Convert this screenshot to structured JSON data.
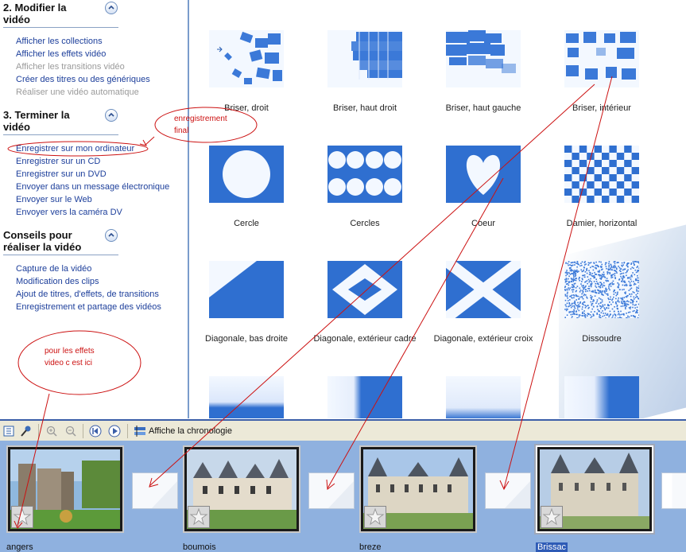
{
  "tasks": {
    "section2": {
      "title": "2. Modifier la vidéo",
      "title_l1": "2. Modifier la",
      "title_l2": "vidéo",
      "items": [
        "Afficher les collections",
        "Afficher les effets vidéo",
        "Afficher les transitions vidéo",
        "Créer des titres ou des génériques",
        "Réaliser une vidéo automatique"
      ]
    },
    "section3": {
      "title_l1": "3. Terminer la",
      "title_l2": "vidéo",
      "items": [
        "Enregistrer sur mon ordinateur",
        "Enregistrer sur un CD",
        "Enregistrer sur un DVD",
        "Envoyer dans un message électronique",
        "Envoyer sur le Web",
        "Envoyer vers la caméra DV"
      ]
    },
    "tips": {
      "title_l1": "Conseils pour",
      "title_l2": "réaliser la vidéo",
      "items": [
        "Capture de la vidéo",
        "Modification des clips",
        "Ajout de titres, d'effets, de transitions",
        "Enregistrement et partage des vidéos"
      ]
    }
  },
  "effects": [
    "Briser, droit",
    "Briser, haut droit",
    "Briser, haut gauche",
    "Briser, intérieur",
    "Cercle",
    "Cercles",
    "Coeur",
    "Damier, horizontal",
    "Diagonale, bas droite",
    "Diagonale, extérieur cadre",
    "Diagonale, extérieur croix",
    "Dissoudre"
  ],
  "toolbar": {
    "timeline_label": "Affiche la chronologie"
  },
  "clips": [
    "angers",
    "boumois",
    "breze",
    "Brissac"
  ],
  "annotations": {
    "final_l1": "enregistrement",
    "final_l2": "final",
    "effects_l1": "pour les effets",
    "effects_l2": "video c est ici"
  },
  "colors": {
    "link": "#1d3f9b",
    "annotation": "#cc1111",
    "storyboard": "#8fb1df",
    "effect_blue": "#2f6fd0"
  }
}
